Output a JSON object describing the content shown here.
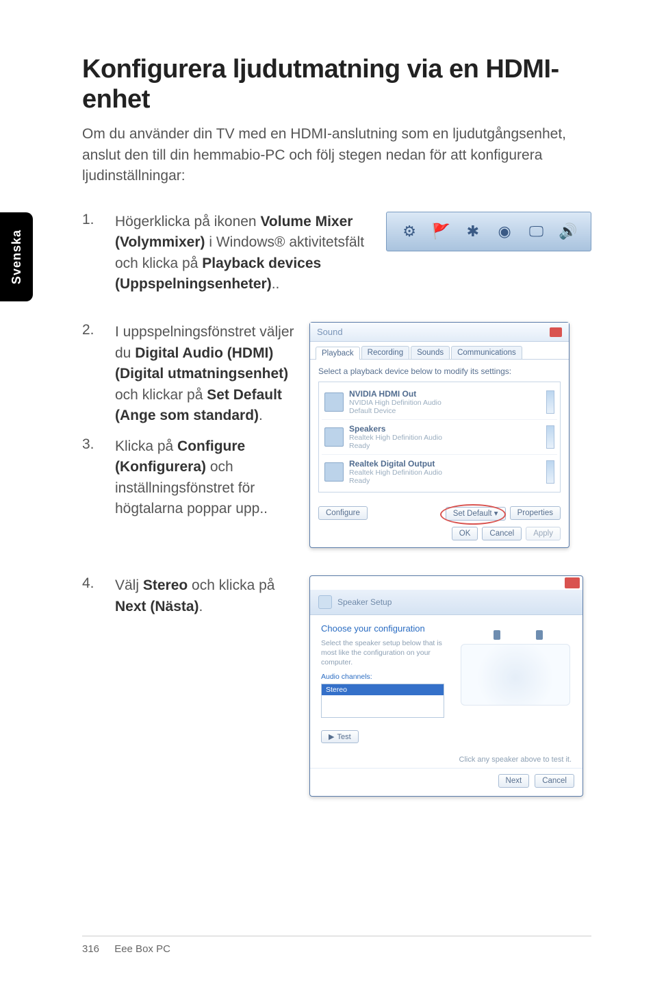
{
  "sideTab": "Svenska",
  "heading": "Konfigurera ljudutmatning via en HDMI-enhet",
  "intro": "Om du använder din TV med en HDMI-anslutning som en ljudutgångsenhet, anslut den till din hemmabio-PC och följ stegen nedan för att konfigurera ljudinställningar:",
  "steps": {
    "s1": {
      "num": "1.",
      "t1": "Högerklicka på ikonen ",
      "b1": "Volume Mixer (Volymmixer)",
      "t2": " i Windows® aktivitetsfält och klicka på ",
      "b2": "Playback devices (Uppspelningsenheter)",
      "t3": ".."
    },
    "s2": {
      "num": "2.",
      "t1": "I uppspelningsfönstret väljer du ",
      "b1": "Digital Audio (HDMI) (Digital utmatningsenhet)",
      "t2": " och klickar på ",
      "b2": "Set Default (Ange som standard)",
      "t3": "."
    },
    "s3": {
      "num": "3.",
      "t1": "Klicka på ",
      "b1": "Configure (Konfigurera)",
      "t2": " och inställningsfönstret för högtalarna poppar upp.."
    },
    "s4": {
      "num": "4.",
      "t1": "Välj ",
      "b1": "Stereo",
      "t2": " och klicka på ",
      "b2": "Next (Nästa)",
      "t3": "."
    }
  },
  "trayIcons": [
    "⚙",
    "🚩",
    "✱",
    "◉",
    "🖵",
    "🔊"
  ],
  "soundDialog": {
    "title": "Sound",
    "tabs": [
      "Playback",
      "Recording",
      "Sounds",
      "Communications"
    ],
    "subLabel": "Select a playback device below to modify its settings:",
    "devices": [
      {
        "name": "NVIDIA HDMI Out",
        "sub": "NVIDIA High Definition Audio",
        "status": "Default Device"
      },
      {
        "name": "Speakers",
        "sub": "Realtek High Definition Audio",
        "status": "Ready"
      },
      {
        "name": "Realtek Digital Output",
        "sub": "Realtek High Definition Audio",
        "status": "Ready"
      }
    ],
    "configure": "Configure",
    "setDefault": "Set Default",
    "properties": "Properties",
    "ok": "OK",
    "cancel": "Cancel",
    "apply": "Apply"
  },
  "speakerDialog": {
    "header": "Speaker Setup",
    "choose": "Choose your configuration",
    "desc": "Select the speaker setup below that is most like the configuration on your computer.",
    "label": "Audio channels:",
    "selected": "Stereo",
    "test": "Test",
    "note": "Click any speaker above to test it.",
    "next": "Next",
    "cancel": "Cancel"
  },
  "footer": {
    "page": "316",
    "title": "Eee Box PC"
  }
}
